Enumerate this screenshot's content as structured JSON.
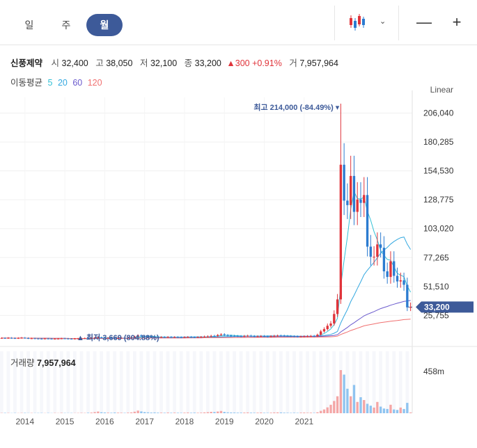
{
  "tabs": [
    {
      "label": "일",
      "active": false
    },
    {
      "label": "주",
      "active": false
    },
    {
      "label": "월",
      "active": true
    }
  ],
  "controls": {
    "minus": "—",
    "plus": "+",
    "chart_type_icon": "candlestick-icon",
    "dropdown_icon": "chevron-down-icon"
  },
  "stock": {
    "name": "신풍제약",
    "open_label": "시",
    "open": "32,400",
    "high_label": "고",
    "high": "38,050",
    "low_label": "저",
    "low": "32,100",
    "close_label": "종",
    "close": "33,200",
    "change": "▲300 +0.91%",
    "volume_label": "거",
    "volume": "7,957,964"
  },
  "moving_average": {
    "label": "이동평균",
    "periods": [
      {
        "p": "5",
        "color": "#33c1d6"
      },
      {
        "p": "20",
        "color": "#33a8e0"
      },
      {
        "p": "60",
        "color": "#6a5acd"
      },
      {
        "p": "120",
        "color": "#f07070"
      }
    ]
  },
  "scale_type": "Linear",
  "colors": {
    "up": "#e0333a",
    "down": "#2b7bd0",
    "price_tag": "#3d5a99",
    "volume_up": "#f4a6a6",
    "volume_down": "#8fc4f0"
  },
  "chart_data": {
    "type": "candlestick",
    "y_ticks": [
      206040,
      180285,
      154530,
      128775,
      103020,
      77265,
      51510,
      25755
    ],
    "y_tick_labels": [
      "206,040",
      "180,285",
      "154,530",
      "128,775",
      "103,020",
      "77,265",
      "51,510",
      "25,755"
    ],
    "ylim": [
      8000,
      220000
    ],
    "x_tick_labels": [
      "2014",
      "2015",
      "2016",
      "2017",
      "2018",
      "2019",
      "2020",
      "2021"
    ],
    "x_start": "2013-06",
    "current_price": 33200,
    "current_price_label": "33,200",
    "high_annotation": "최고 214,000 (-84.49%)",
    "low_annotation": "최저 3,669 (804.88%)",
    "volume_label": "거래량",
    "volume_value": "7,957,964",
    "volume_axis_label": "458m",
    "volume_axis_value": 458000000,
    "monthly_close": [
      5600,
      5400,
      5700,
      5500,
      5300,
      5600,
      5800,
      5500,
      5200,
      5300,
      5100,
      5000,
      4900,
      5100,
      5000,
      4800,
      4900,
      5000,
      5200,
      5100,
      4900,
      4800,
      5000,
      5100,
      5200,
      5400,
      5300,
      5600,
      5900,
      6100,
      5800,
      5600,
      5700,
      5500,
      5400,
      5600,
      5700,
      5500,
      5800,
      6200,
      6800,
      7900,
      7400,
      7000,
      6800,
      6600,
      6500,
      6300,
      6400,
      6300,
      6500,
      6200,
      6400,
      6300,
      6100,
      6400,
      6500,
      6300,
      6200,
      6400,
      6600,
      6900,
      7100,
      7500,
      7300,
      8200,
      8800,
      8100,
      7700,
      7500,
      7400,
      7300,
      7200,
      7400,
      7600,
      7300,
      6900,
      7100,
      7300,
      7000,
      6700,
      7200,
      7500,
      7700,
      7600,
      7400,
      7300,
      7100,
      7000,
      6800,
      6900,
      7100,
      7300,
      7400,
      7200,
      8500,
      11500,
      13500,
      16500,
      18500,
      27000,
      40000,
      160000,
      128000,
      124000,
      150000,
      118000,
      129000,
      126000,
      133000,
      87000,
      78000,
      78000,
      89000,
      86000,
      65000,
      60000,
      74000,
      61000,
      56000,
      57000,
      53000,
      32900,
      33200
    ],
    "monthly_volume_millions": [
      3,
      4,
      3,
      2,
      3,
      2,
      3,
      4,
      2,
      3,
      2,
      3,
      3,
      2,
      3,
      2,
      3,
      2,
      4,
      3,
      2,
      3,
      2,
      3,
      4,
      3,
      5,
      7,
      12,
      18,
      10,
      8,
      6,
      5,
      7,
      6,
      5,
      4,
      6,
      9,
      16,
      28,
      19,
      12,
      9,
      7,
      8,
      6,
      6,
      5,
      7,
      5,
      6,
      5,
      4,
      6,
      7,
      5,
      6,
      5,
      6,
      9,
      11,
      15,
      13,
      18,
      24,
      14,
      9,
      8,
      7,
      6,
      6,
      7,
      8,
      6,
      5,
      6,
      7,
      5,
      4,
      6,
      8,
      9,
      8,
      6,
      5,
      4,
      5,
      4,
      6,
      7,
      5,
      6,
      4,
      10,
      25,
      40,
      62,
      90,
      130,
      180,
      458,
      410,
      260,
      180,
      300,
      120,
      170,
      140,
      100,
      80,
      60,
      120,
      70,
      50,
      45,
      90,
      40,
      35,
      60,
      45,
      110,
      8
    ]
  }
}
